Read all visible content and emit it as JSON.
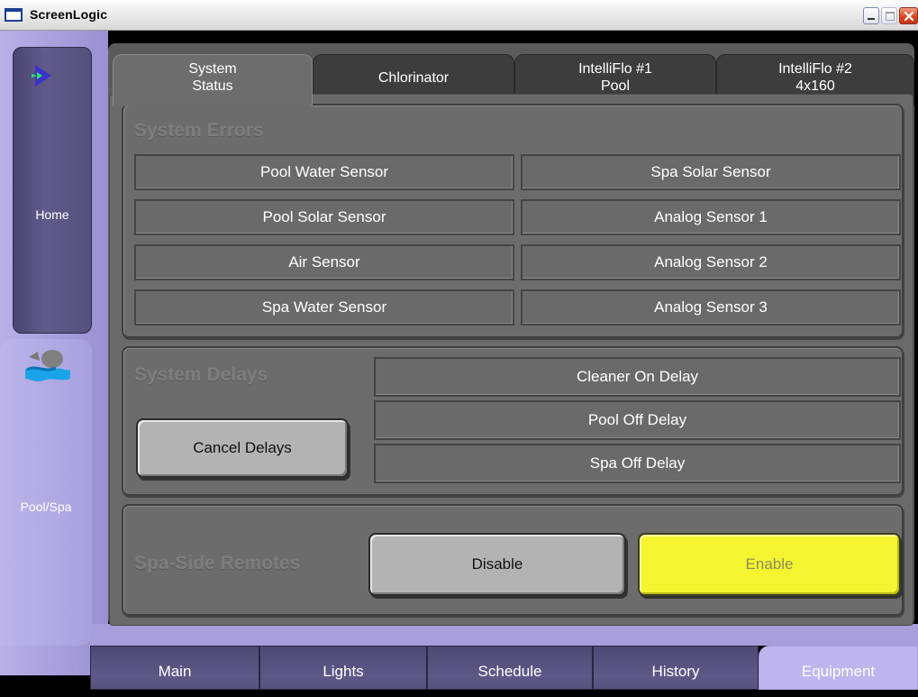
{
  "window": {
    "title": "ScreenLogic",
    "controls": {
      "minimize": "minimize-icon",
      "maximize": "maximize-icon",
      "close": "close-icon"
    }
  },
  "sidebar": {
    "items": [
      {
        "label": "Home",
        "icon": "pentair-logo-icon"
      },
      {
        "label": "Pool/Spa",
        "icon": "pool-spa-icon"
      }
    ]
  },
  "tabs": [
    {
      "line1": "System",
      "line2": "Status",
      "active": true
    },
    {
      "line1": "Chlorinator",
      "line2": "",
      "active": false
    },
    {
      "line1": "IntelliFlo #1",
      "line2": "Pool",
      "active": false
    },
    {
      "line1": "IntelliFlo #2",
      "line2": "4x160",
      "active": false
    }
  ],
  "system_errors": {
    "title": "System Errors",
    "cells": [
      "Pool Water Sensor",
      "Spa Solar Sensor",
      "Pool Solar Sensor",
      "Analog Sensor 1",
      "Air Sensor",
      "Analog Sensor 2",
      "Spa Water Sensor",
      "Analog Sensor 3"
    ]
  },
  "system_delays": {
    "title": "System Delays",
    "cancel_label": "Cancel Delays",
    "items": [
      "Cleaner On Delay",
      "Pool Off Delay",
      "Spa Off Delay"
    ]
  },
  "spa_side_remotes": {
    "title": "Spa-Side Remotes",
    "disable_label": "Disable",
    "enable_label": "Enable"
  },
  "bottom_nav": [
    {
      "label": "Main",
      "active": false
    },
    {
      "label": "Lights",
      "active": false
    },
    {
      "label": "Schedule",
      "active": false
    },
    {
      "label": "History",
      "active": false
    },
    {
      "label": "Equipment",
      "active": true
    }
  ],
  "colors": {
    "accent_lavender": "#beb5ef",
    "enable_yellow": "#f4f431",
    "panel_grey": "#6a6a6a"
  }
}
